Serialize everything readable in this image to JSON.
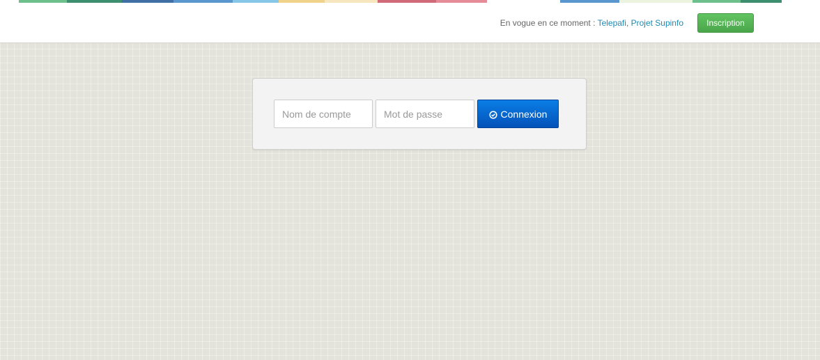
{
  "strip_colors": [
    "#ffffff",
    "#6dbf8b",
    "#3d8f6f",
    "#3f6fa4",
    "#5b97cf",
    "#86c6e6",
    "#f0d28a",
    "#f6e7bf",
    "#d06a78",
    "#e58c98",
    "#ffffff",
    "#5b97cf",
    "#ecf3df",
    "#6dbf8b",
    "#3d8f6f",
    "#ffffff"
  ],
  "header": {
    "trending_label": "En vogue en ce moment : ",
    "trending_links": [
      "Telepafi",
      "Projet Supinfo"
    ],
    "trending_separator": ", ",
    "signup_label": "Inscription"
  },
  "login": {
    "username_placeholder": "Nom de compte",
    "password_placeholder": "Mot de passe",
    "submit_label": "Connexion",
    "submit_icon": "check-circle-icon"
  }
}
